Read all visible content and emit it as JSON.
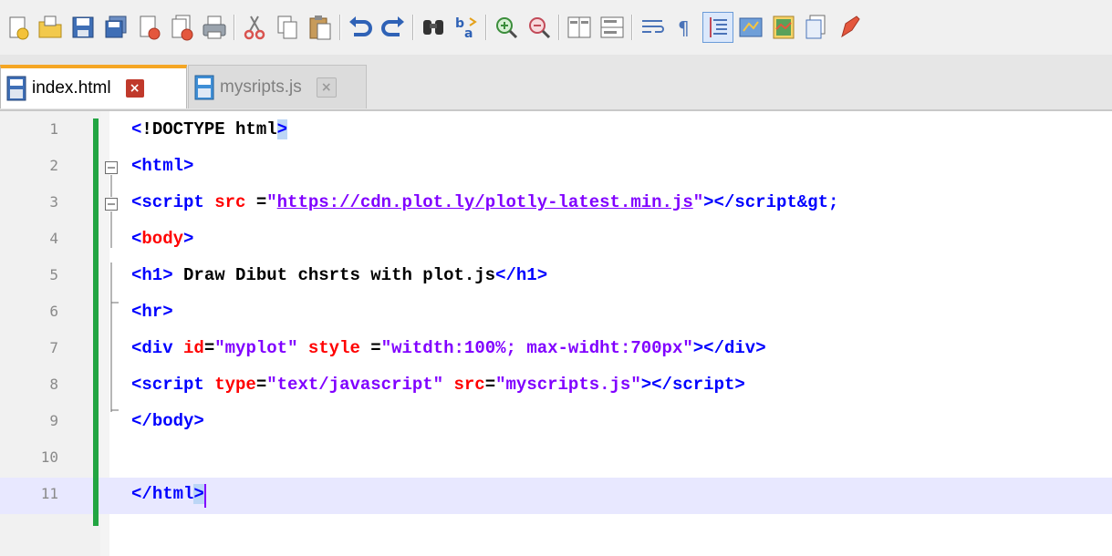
{
  "toolbar": {
    "icons": [
      "new-file-icon",
      "open-file-icon",
      "save-icon",
      "save-all-icon",
      "close-icon",
      "close-all-icon",
      "print-icon",
      "cut-icon",
      "copy-icon",
      "paste-icon",
      "undo-icon",
      "redo-icon",
      "find-icon",
      "replace-icon",
      "zoom-in-icon",
      "zoom-out-icon",
      "sync-vertical-icon",
      "sync-horizontal-icon",
      "word-wrap-icon",
      "show-all-chars-icon",
      "indent-guide-icon",
      "user-language-icon",
      "document-map-icon",
      "function-list-icon",
      "macro-record-icon"
    ]
  },
  "tabs": [
    {
      "label": "index.html",
      "close": "×",
      "active": true
    },
    {
      "label": "mysripts.js",
      "close": "×",
      "active": false
    }
  ],
  "editor": {
    "current_line": 11,
    "lines": [
      {
        "num": "1",
        "tokens": [
          {
            "t": "<",
            "c": "tag"
          },
          {
            "t": "!",
            "c": "text"
          },
          {
            "t": "DOCTYPE html",
            "c": "text"
          },
          {
            "t": ">",
            "c": "tag hl"
          }
        ]
      },
      {
        "num": "2",
        "tokens": [
          {
            "t": "<",
            "c": "tag"
          },
          {
            "t": "html",
            "c": "name"
          },
          {
            "t": ">",
            "c": "tag"
          }
        ]
      },
      {
        "num": "3",
        "tokens": [
          {
            "t": "<",
            "c": "tag"
          },
          {
            "t": "script",
            "c": "name"
          },
          {
            "t": " src ",
            "c": "attr"
          },
          {
            "t": "=",
            "c": "eq"
          },
          {
            "t": "\"",
            "c": "str"
          },
          {
            "t": "https://cdn.plot.ly/plotly-latest.min.js",
            "c": "url"
          },
          {
            "t": "\"",
            "c": "str"
          },
          {
            "t": "></",
            "c": "tag"
          },
          {
            "t": "script",
            "c": "name"
          },
          {
            "t": "&gt;",
            "c": "tag"
          }
        ]
      },
      {
        "num": "4",
        "tokens": [
          {
            "t": "<",
            "c": "tag"
          },
          {
            "t": "body",
            "c": "attr"
          },
          {
            "t": ">",
            "c": "tag"
          }
        ]
      },
      {
        "num": "5",
        "tokens": [
          {
            "t": "<",
            "c": "tag"
          },
          {
            "t": "h1",
            "c": "name"
          },
          {
            "t": ">",
            "c": "tag"
          },
          {
            "t": " Draw Dibut chsrts with plot.js",
            "c": "text"
          },
          {
            "t": "</",
            "c": "tag"
          },
          {
            "t": "h1",
            "c": "name"
          },
          {
            "t": ">",
            "c": "tag"
          }
        ]
      },
      {
        "num": "6",
        "tokens": [
          {
            "t": "<",
            "c": "tag"
          },
          {
            "t": "hr",
            "c": "name"
          },
          {
            "t": ">",
            "c": "tag"
          }
        ]
      },
      {
        "num": "7",
        "tokens": [
          {
            "t": "<",
            "c": "tag"
          },
          {
            "t": "div",
            "c": "name"
          },
          {
            "t": " id",
            "c": "attr"
          },
          {
            "t": "=",
            "c": "eq"
          },
          {
            "t": "\"myplot\"",
            "c": "str"
          },
          {
            "t": " style ",
            "c": "attr"
          },
          {
            "t": "=",
            "c": "eq"
          },
          {
            "t": "\"witdth:100%; max-widht:700px\"",
            "c": "str"
          },
          {
            "t": "></",
            "c": "tag"
          },
          {
            "t": "div",
            "c": "name"
          },
          {
            "t": ">",
            "c": "tag"
          }
        ]
      },
      {
        "num": "8",
        "tokens": [
          {
            "t": "<",
            "c": "tag"
          },
          {
            "t": "script",
            "c": "name"
          },
          {
            "t": " type",
            "c": "attr"
          },
          {
            "t": "=",
            "c": "eq"
          },
          {
            "t": "\"text/javascript\"",
            "c": "str"
          },
          {
            "t": " src",
            "c": "attr"
          },
          {
            "t": "=",
            "c": "eq"
          },
          {
            "t": "\"myscripts.js\"",
            "c": "str"
          },
          {
            "t": "></",
            "c": "tag"
          },
          {
            "t": "script",
            "c": "name"
          },
          {
            "t": ">",
            "c": "tag"
          }
        ]
      },
      {
        "num": "9",
        "tokens": [
          {
            "t": "</",
            "c": "tag"
          },
          {
            "t": "body",
            "c": "name"
          },
          {
            "t": ">",
            "c": "tag"
          }
        ]
      },
      {
        "num": "10",
        "tokens": []
      },
      {
        "num": "11",
        "tokens": [
          {
            "t": "</",
            "c": "tag"
          },
          {
            "t": "html",
            "c": "name"
          },
          {
            "t": ">",
            "c": "tag hl"
          }
        ]
      }
    ]
  },
  "colors": {
    "tag": "#0000ff",
    "attr": "#ff0000",
    "string": "#8000ff",
    "change_bar": "#22a542",
    "current_line": "#e8e8ff",
    "active_tab_accent": "#f5a623"
  }
}
